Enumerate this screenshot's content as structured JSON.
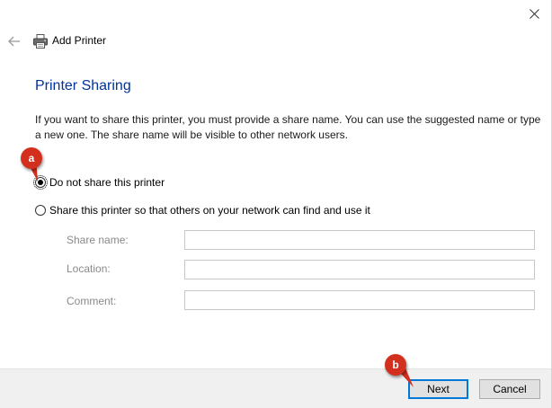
{
  "window": {
    "title": "Add Printer"
  },
  "icons": {
    "close": "close-icon",
    "back": "back-arrow-icon",
    "printer": "printer-icon"
  },
  "section": {
    "title": "Printer Sharing",
    "description": "If you want to share this printer, you must provide a share name. You can use the suggested name or type a new one. The share name will be visible to other network users."
  },
  "options": [
    {
      "label": "Do not share this printer",
      "selected": true
    },
    {
      "label": "Share this printer so that others on your network can find and use it",
      "selected": false
    }
  ],
  "fields": {
    "share_name": {
      "label": "Share name:",
      "value": ""
    },
    "location": {
      "label": "Location:",
      "value": ""
    },
    "comment": {
      "label": "Comment:",
      "value": ""
    }
  },
  "buttons": {
    "next": "Next",
    "cancel": "Cancel"
  },
  "annotations": {
    "a": "a",
    "b": "b"
  },
  "colors": {
    "accent": "#0078d7",
    "title_blue": "#003399",
    "callout": "#d32f1f",
    "footer_bg": "#f0f0f0"
  }
}
